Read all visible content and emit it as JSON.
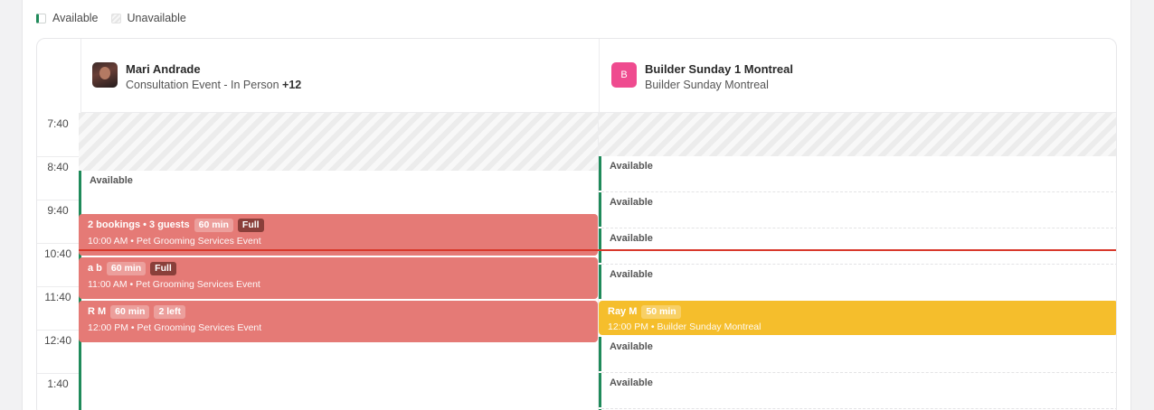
{
  "legend": {
    "available": "Available",
    "unavailable": "Unavailable"
  },
  "columns": [
    {
      "name": "Mari Andrade",
      "subtitle": "Consultation Event - In Person",
      "extra": "+12",
      "avatar_type": "photo",
      "available_label": "Available",
      "events": [
        {
          "title": "2 bookings • 3 guests",
          "duration": "60 min",
          "status": "Full",
          "time": "10:00 AM",
          "event_name": "Pet Grooming Services Event",
          "color": "#e57a76"
        },
        {
          "title": "a b",
          "duration": "60 min",
          "status": "Full",
          "time": "11:00 AM",
          "event_name": "Pet Grooming Services Event",
          "color": "#e57a76"
        },
        {
          "title": "R M",
          "duration": "60 min",
          "status": "2 left",
          "time": "12:00 PM",
          "event_name": "Pet Grooming Services Event",
          "color": "#e57a76"
        }
      ]
    },
    {
      "name": "Builder Sunday 1 Montreal",
      "subtitle": "Builder Sunday Montreal",
      "avatar_letter": "B",
      "avatar_color": "#ef4b8f",
      "slots": [
        "Available",
        "Available",
        "Available",
        "Available",
        "Available",
        "Available"
      ],
      "events": [
        {
          "title": "Ray M",
          "duration": "50 min",
          "time": "12:00 PM",
          "event_name": "Builder Sunday Montreal",
          "color": "#f5be2c"
        }
      ]
    }
  ],
  "times": [
    "7:40",
    "8:40",
    "9:40",
    "10:40",
    "11:40",
    "12:40",
    "1:40"
  ],
  "colors": {
    "available": "#1f8a5a",
    "now_line": "#d8382b",
    "booked": "#e57a76",
    "pending": "#f5be2c"
  }
}
